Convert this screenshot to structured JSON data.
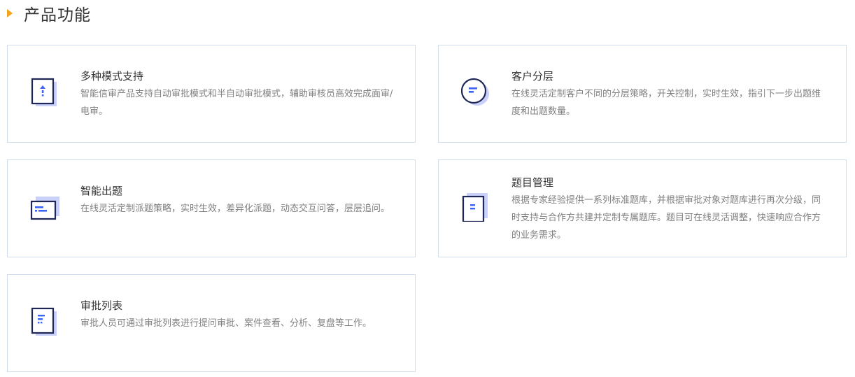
{
  "section": {
    "title": "产品功能",
    "accent_color": "#f5a31a"
  },
  "icon_colors": {
    "outline": "#1e2756",
    "shadow": "#c9d1fb",
    "accent": "#3d63f6"
  },
  "features": [
    {
      "icon": "document-upload-icon",
      "title": "多种模式支持",
      "desc": "智能信审产品支持自动审批模式和半自动审批模式，辅助审核员高效完成面审/电审。"
    },
    {
      "icon": "layers-circle-icon",
      "title": "客户分层",
      "desc": "在线灵活定制客户不同的分层策略，开关控制，实时生效，指引下一步出题维度和出题数量。"
    },
    {
      "icon": "question-card-icon",
      "title": "智能出题",
      "desc": "在线灵活定制派题策略，实时生效，差异化派题，动态交互问答，层层追问。"
    },
    {
      "icon": "question-bank-icon",
      "title": "题目管理",
      "desc": "根据专家经验提供一系列标准题库，并根据审批对象对题库进行再次分级，同时支持与合作方共建并定制专属题库。题目可在线灵活调整，快速响应合作方的业务需求。"
    },
    {
      "icon": "approval-list-icon",
      "title": "审批列表",
      "desc": "审批人员可通过审批列表进行提问审批、案件查看、分析、复盘等工作。"
    }
  ]
}
